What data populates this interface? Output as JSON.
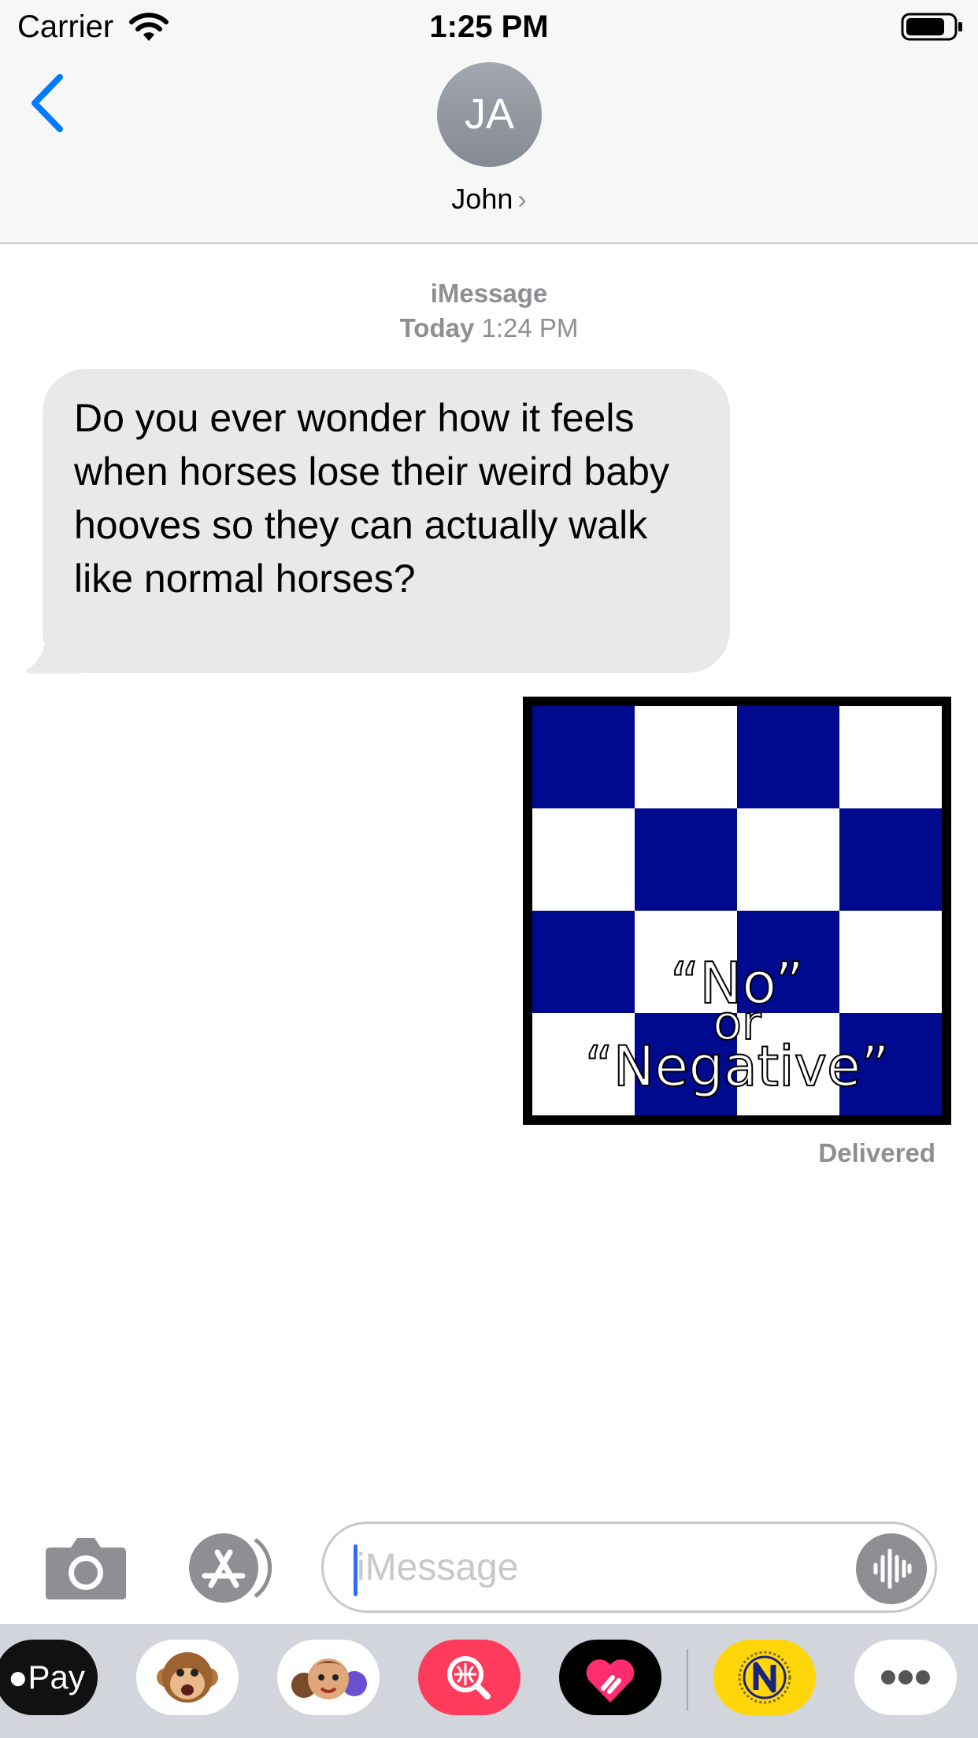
{
  "status_bar": {
    "carrier": "Carrier",
    "time": "1:25 PM"
  },
  "header": {
    "avatar_initials": "JA",
    "contact_name": "John",
    "chevron": "›"
  },
  "conversation": {
    "service_label": "iMessage",
    "timestamp_day": "Today",
    "timestamp_time": "1:24 PM",
    "incoming_message": "Do you ever wonder how it feels when horses lose their weird baby hooves so they can actually walk like normal horses?",
    "sticker": {
      "line1": "“No”",
      "line2": "or",
      "line3": "“Negative”",
      "colors": {
        "blue": "#000a8f",
        "white": "#ffffff",
        "border": "#000000"
      }
    },
    "delivery_status": "Delivered"
  },
  "composer": {
    "placeholder": "iMessage"
  },
  "app_drawer": {
    "apple_pay_label": "Pay",
    "apps": [
      "apple-pay-icon",
      "animoji-monkey-icon",
      "memoji-icon",
      "image-search-icon",
      "digital-touch-heart-icon",
      "n-flag-sticker-icon",
      "more-icon"
    ]
  },
  "colors": {
    "accent": "#007aff",
    "bubble_gray": "#e9e9eb",
    "secondary_text": "#8e8e93"
  }
}
